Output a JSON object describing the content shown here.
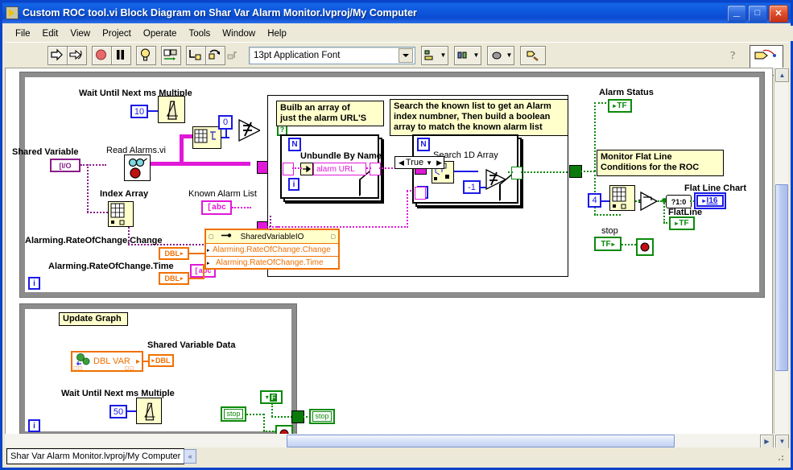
{
  "window": {
    "title": "Custom ROC tool.vi Block Diagram on Shar Var Alarm Monitor.lvproj/My Computer",
    "icon": "labview-vi-icon",
    "buttons": {
      "minimize": "_",
      "maximize": "□",
      "close": "✕"
    }
  },
  "menu": {
    "items": [
      "File",
      "Edit",
      "View",
      "Project",
      "Operate",
      "Tools",
      "Window",
      "Help"
    ]
  },
  "toolbar": {
    "buttons": [
      {
        "name": "run-button",
        "icon": "run-arrow-icon"
      },
      {
        "name": "run-continuously-button",
        "icon": "run-continuously-icon"
      },
      {
        "name": "abort-button",
        "icon": "abort-stop-icon"
      },
      {
        "name": "pause-button",
        "icon": "pause-icon"
      },
      {
        "name": "highlight-execution-button",
        "icon": "lightbulb-icon"
      },
      {
        "name": "retain-wire-values-button",
        "icon": "retain-wire-values-icon"
      },
      {
        "name": "step-into-button",
        "icon": "step-into-icon"
      },
      {
        "name": "step-over-button",
        "icon": "step-over-icon"
      },
      {
        "name": "step-out-button",
        "icon": "step-out-icon"
      }
    ],
    "font_selector": {
      "value": "13pt Application Font",
      "placeholder": "13pt Application Font"
    },
    "align_objects": {
      "name": "align-objects-button",
      "icon": "align-objects-icon"
    },
    "distribute_objects": {
      "name": "distribute-objects-button",
      "icon": "distribute-objects-icon"
    },
    "reorder": {
      "name": "reorder-button",
      "icon": "reorder-icon"
    },
    "clean_up_diagram": {
      "name": "clean-up-diagram-button",
      "icon": "clean-up-diagram-icon"
    },
    "context_help": {
      "name": "context-help-button",
      "icon": "question-mark-icon"
    },
    "vi_icon": {
      "name": "vi-icon-pane",
      "label": "1"
    }
  },
  "diagram": {
    "top_loop": {
      "name": "main-while-loop",
      "iteration_label": "i",
      "wait_label": "Wait Until Next ms Multiple",
      "wait_constant": "10",
      "shared_variable_label": "Shared Variable",
      "shared_variable_terminal": "[I/O",
      "read_alarms_label": "Read Alarms.vi",
      "array_size_constant": "0",
      "index_array_label": "Index Array",
      "known_alarm_list_label": "Known Alarm List",
      "known_alarm_list_terminal": "[abc",
      "case": {
        "selector_value": "True",
        "left_arrow": "◀",
        "right_arrow": "▶",
        "dropdown": "▼",
        "comment_left": "Builb an array of\njust the alarm URL'S",
        "comment_right": "Search the known list to get an Alarm\nindex numbner, Then build a boolean\narray to match the known alarm list",
        "left_for_loop": {
          "count": "N",
          "iteration": "i",
          "node_label": "Unbundle By Name",
          "element": "alarm URL"
        },
        "right_for_loop": {
          "count": "N",
          "iteration": "i",
          "node_label": "Search 1D Array",
          "constant": "-1"
        }
      },
      "alarm_status_label": "Alarm Status",
      "alarm_status_terminal": "TF",
      "monitor_comment": "Monitor Flat Line\nConditions for the ROC",
      "index_constant": "4",
      "flat_line_chart_label": "Flat Line Chart",
      "flat_line_chart_terminal": "I16",
      "select_node": "?1:0",
      "flatline_label": "FlatLine",
      "flatline_terminal": "TF",
      "stop_label": "stop",
      "stop_terminal": "TF"
    },
    "shared_variable_io": {
      "node_title": "SharedVariableIO",
      "input_label_1": "Alarming.RateOfChange.Change",
      "input_label_2": "Alarming.RateOfChange.Time",
      "control_label_1": "Alarming.RateOfChange.Change",
      "control_label_2": "Alarming.RateOfChange.Time",
      "control_terminal_1": "DBL",
      "control_terminal_2": "DBL"
    },
    "bottom_loop": {
      "name": "update-graph-while-loop",
      "comment": "Update Graph",
      "iteration_label": "i",
      "shared_variable_node": "DBL VAR",
      "shared_variable_data_label": "Shared Variable Data",
      "shared_variable_data_terminal": "DBL",
      "wait_label": "Wait Until Next ms Multiple",
      "wait_constant": "50",
      "stop_local_1": "stop",
      "stop_local_2": "stop",
      "false_constant": "F"
    }
  },
  "statusbar": {
    "path": "Shar Var Alarm Monitor.lvproj/My Computer",
    "nav_button": "«"
  },
  "scrollbars": {
    "up": "▲",
    "down": "▼",
    "left": "◀",
    "right": "▶"
  },
  "colors": {
    "title_blue": "#0A4BD0",
    "window_face": "#ECE9D8",
    "canvas": "#FFFFFF",
    "wire_pink": "#E018D8",
    "wire_green": "#0A8A0A",
    "wire_blue": "#1A1AE6",
    "wire_purple": "#8A1C8A",
    "wire_orange": "#F07000",
    "node_yellow": "#FFFFCC",
    "loop_gray": "#8C8C8C"
  }
}
